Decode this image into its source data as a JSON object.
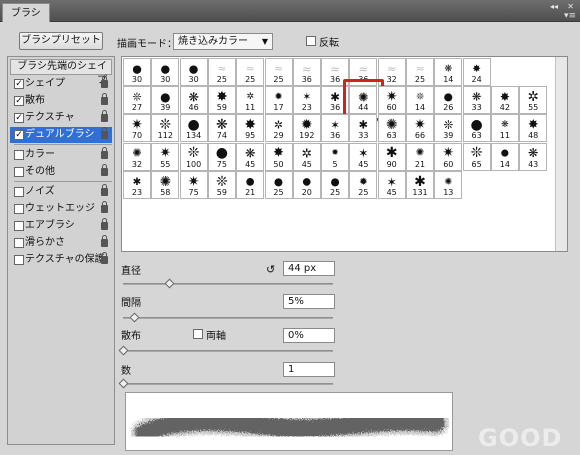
{
  "window": {
    "title": "ブラシ",
    "collapse_glyph": "◂◂",
    "close_glyph": "✕",
    "menu_glyph": "▾≡"
  },
  "top": {
    "preset_button": "ブラシプリセット",
    "mode_label": "描画モード：",
    "mode_value": "焼き込みカラー",
    "flip_label": "反転",
    "flip_checked": false
  },
  "options": {
    "header": "ブラシ先端のシェイプ",
    "items": [
      {
        "label": "シェイプ",
        "checked": true,
        "active": false
      },
      {
        "label": "散布",
        "checked": true,
        "active": false
      },
      {
        "label": "テクスチャ",
        "checked": true,
        "active": false
      },
      {
        "label": "デュアルブラシ",
        "checked": true,
        "active": true
      },
      {
        "label": "カラー",
        "checked": false,
        "active": false
      },
      {
        "label": "その他",
        "checked": false,
        "active": false
      },
      {
        "label": "ノイズ",
        "checked": false,
        "active": false
      },
      {
        "label": "ウェットエッジ",
        "checked": false,
        "active": false
      },
      {
        "label": "エアブラシ",
        "checked": false,
        "active": false
      },
      {
        "label": "滑らかさ",
        "checked": false,
        "active": false
      },
      {
        "label": "テクスチャの保護",
        "checked": false,
        "active": false
      }
    ]
  },
  "brushes": {
    "rows": [
      [
        "30",
        "30",
        "30",
        "25",
        "25",
        "25",
        "36",
        "36",
        "36",
        "32",
        "25",
        "14",
        "24"
      ],
      [
        "27",
        "39",
        "46",
        "59",
        "11",
        "17",
        "23",
        "36",
        "44",
        "60",
        "14",
        "26",
        "33",
        "42",
        "55"
      ],
      [
        "70",
        "112",
        "134",
        "74",
        "95",
        "29",
        "192",
        "36",
        "33",
        "63",
        "66",
        "39",
        "63",
        "11",
        "48"
      ],
      [
        "32",
        "55",
        "100",
        "75",
        "45",
        "50",
        "45",
        "5",
        "45",
        "90",
        "21",
        "60",
        "65",
        "14",
        "43"
      ],
      [
        "23",
        "58",
        "75",
        "59",
        "21",
        "25",
        "20",
        "25",
        "25",
        "45",
        "131",
        "13"
      ]
    ],
    "selected_size": "44"
  },
  "controls": {
    "diameter_label": "直径",
    "diameter_value": "44 px",
    "diameter_fraction": 0.1,
    "reset_glyph": "↺",
    "spacing_label": "間隔",
    "spacing_value": "5%",
    "spacing_fraction": 0.05,
    "scatter_label": "散布",
    "both_axes_label": "両軸",
    "both_axes_checked": false,
    "scatter_value": "0%",
    "scatter_fraction": 0.0,
    "count_label": "数",
    "count_value": "1",
    "count_fraction": 0.0
  },
  "watermark": "GOOD",
  "colors": {
    "selection": "#2f6fd6",
    "highlight": "#d0241b"
  }
}
